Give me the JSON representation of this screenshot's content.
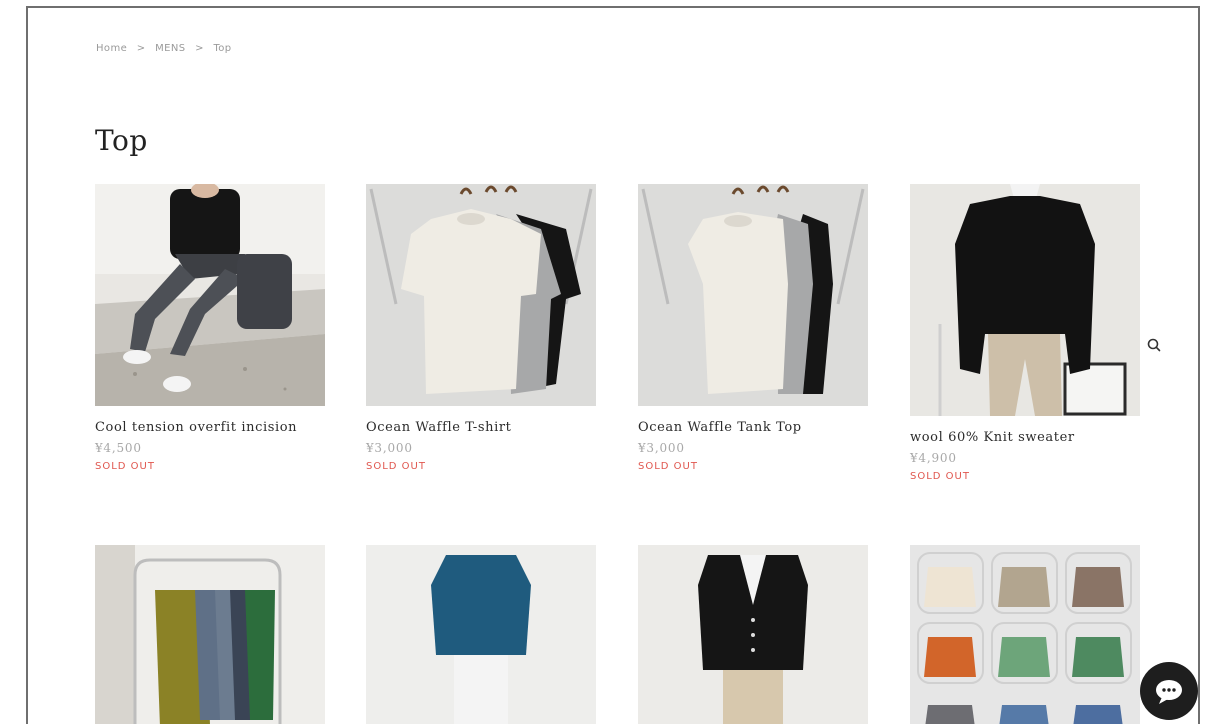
{
  "breadcrumb": {
    "home": "Home",
    "mens": "MENS",
    "current": "Top",
    "separator": ">"
  },
  "page": {
    "title": "Top"
  },
  "products": [
    {
      "name": "Cool tension overfit incision",
      "price": "¥4,500",
      "status": "SOLD OUT"
    },
    {
      "name": "Ocean Waffle T-shirt",
      "price": "¥3,000",
      "status": "SOLD OUT"
    },
    {
      "name": "Ocean Waffle Tank Top",
      "price": "¥3,000",
      "status": "SOLD OUT"
    },
    {
      "name": "wool 60% Knit sweater",
      "price": "¥4,900",
      "status": "SOLD OUT"
    }
  ],
  "icons": {
    "search": "search-icon",
    "chat": "chat-icon"
  },
  "colors": {
    "sold_out": "#e0574f",
    "price": "#a8a8a8",
    "chat_button": "#1e1e1e"
  }
}
